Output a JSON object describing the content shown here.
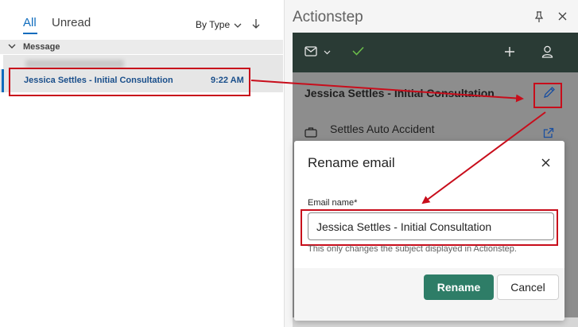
{
  "mail_list": {
    "tabs": [
      {
        "label": "All",
        "active": true
      },
      {
        "label": "Unread",
        "active": false
      }
    ],
    "sort_label": "By Type",
    "group_label": "Message",
    "selected_email": {
      "subject": "Jessica Settles - Initial Consultation",
      "time": "9:22 AM"
    }
  },
  "addin": {
    "title": "Actionstep",
    "toolbar": {
      "icons": [
        "mail-icon",
        "chevron-down-icon",
        "check-icon",
        "plus-icon",
        "user-icon"
      ]
    },
    "email_title": "Jessica Settles - Initial Consultation",
    "matter_name": "Settles Auto Accident"
  },
  "dialog": {
    "title": "Rename email",
    "field_label": "Email name*",
    "field_value": "Jessica Settles - Initial Consultation",
    "hint": "This only changes the subject displayed in Actionstep.",
    "rename_label": "Rename",
    "cancel_label": "Cancel"
  },
  "colors": {
    "accent_blue": "#0f6cbd",
    "toolbar_bg": "#2a3b35",
    "rename_green": "#2e7d67",
    "annotation_red": "#c80d1b"
  }
}
